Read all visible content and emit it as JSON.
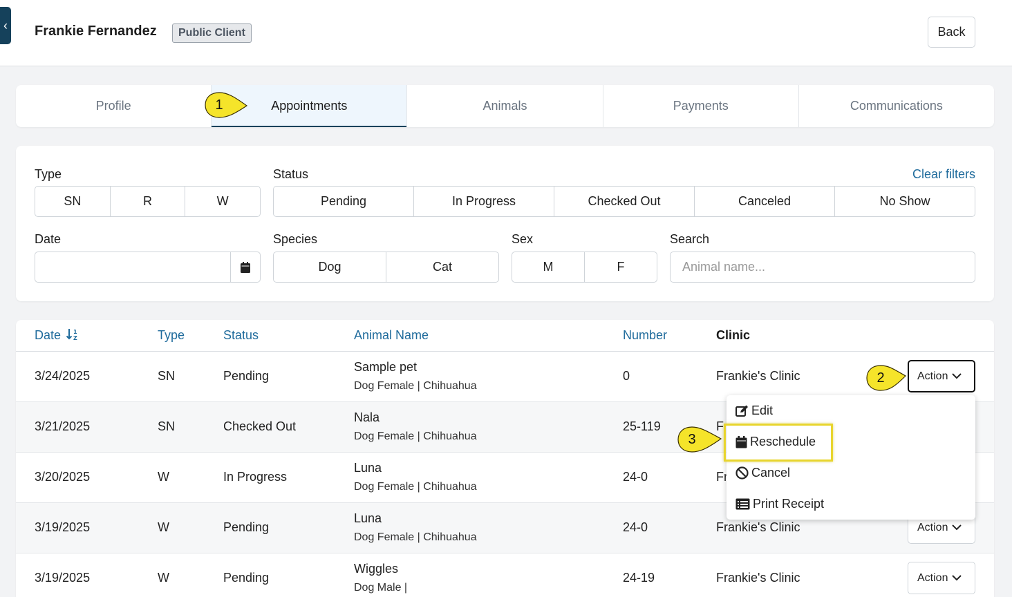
{
  "header": {
    "client_name": "Frankie Fernandez",
    "badge": "Public Client",
    "back_label": "Back"
  },
  "tabs": [
    {
      "label": "Profile",
      "active": false
    },
    {
      "label": "Appointments",
      "active": true
    },
    {
      "label": "Animals",
      "active": false
    },
    {
      "label": "Payments",
      "active": false
    },
    {
      "label": "Communications",
      "active": false
    }
  ],
  "filters": {
    "type_label": "Type",
    "type_options": [
      "SN",
      "R",
      "W"
    ],
    "status_label": "Status",
    "status_options": [
      "Pending",
      "In Progress",
      "Checked Out",
      "Canceled",
      "No Show"
    ],
    "clear_label": "Clear filters",
    "date_label": "Date",
    "date_value": "",
    "species_label": "Species",
    "species_options": [
      "Dog",
      "Cat"
    ],
    "sex_label": "Sex",
    "sex_options": [
      "M",
      "F"
    ],
    "search_label": "Search",
    "search_placeholder": "Animal name..."
  },
  "table": {
    "headers": {
      "date": "Date",
      "type": "Type",
      "status": "Status",
      "animal_name": "Animal Name",
      "number": "Number",
      "clinic": "Clinic"
    },
    "rows": [
      {
        "date": "3/24/2025",
        "type": "SN",
        "status": "Pending",
        "animal": "Sample pet",
        "meta": "Dog Female | Chihuahua",
        "number": "0",
        "clinic": "Frankie's Clinic",
        "action": "Action"
      },
      {
        "date": "3/21/2025",
        "type": "SN",
        "status": "Checked Out",
        "animal": "Nala",
        "meta": "Dog Female | Chihuahua",
        "number": "25-119",
        "clinic": "F",
        "action": ""
      },
      {
        "date": "3/20/2025",
        "type": "W",
        "status": "In Progress",
        "animal": "Luna",
        "meta": "Dog Female | Chihuahua",
        "number": "24-0",
        "clinic": "Fr",
        "action": ""
      },
      {
        "date": "3/19/2025",
        "type": "W",
        "status": "Pending",
        "animal": "Luna",
        "meta": "Dog Female | Chihuahua",
        "number": "24-0",
        "clinic": "Frankie's Clinic",
        "action": "Action"
      },
      {
        "date": "3/19/2025",
        "type": "W",
        "status": "Pending",
        "animal": "Wiggles",
        "meta": "Dog Male |",
        "number": "24-19",
        "clinic": "Frankie's Clinic",
        "action": "Action"
      }
    ]
  },
  "action_menu": {
    "items": [
      {
        "label": "Edit",
        "icon": "edit-icon"
      },
      {
        "label": "Reschedule",
        "icon": "calendar-icon"
      },
      {
        "label": "Cancel",
        "icon": "ban-icon"
      },
      {
        "label": "Print Receipt",
        "icon": "list-icon"
      }
    ]
  },
  "callouts": [
    "1",
    "2",
    "3"
  ],
  "colors": {
    "accent": "#1f6b9c",
    "dark": "#15415b",
    "highlight": "#e8d52e",
    "callout": "#f5e42a"
  }
}
